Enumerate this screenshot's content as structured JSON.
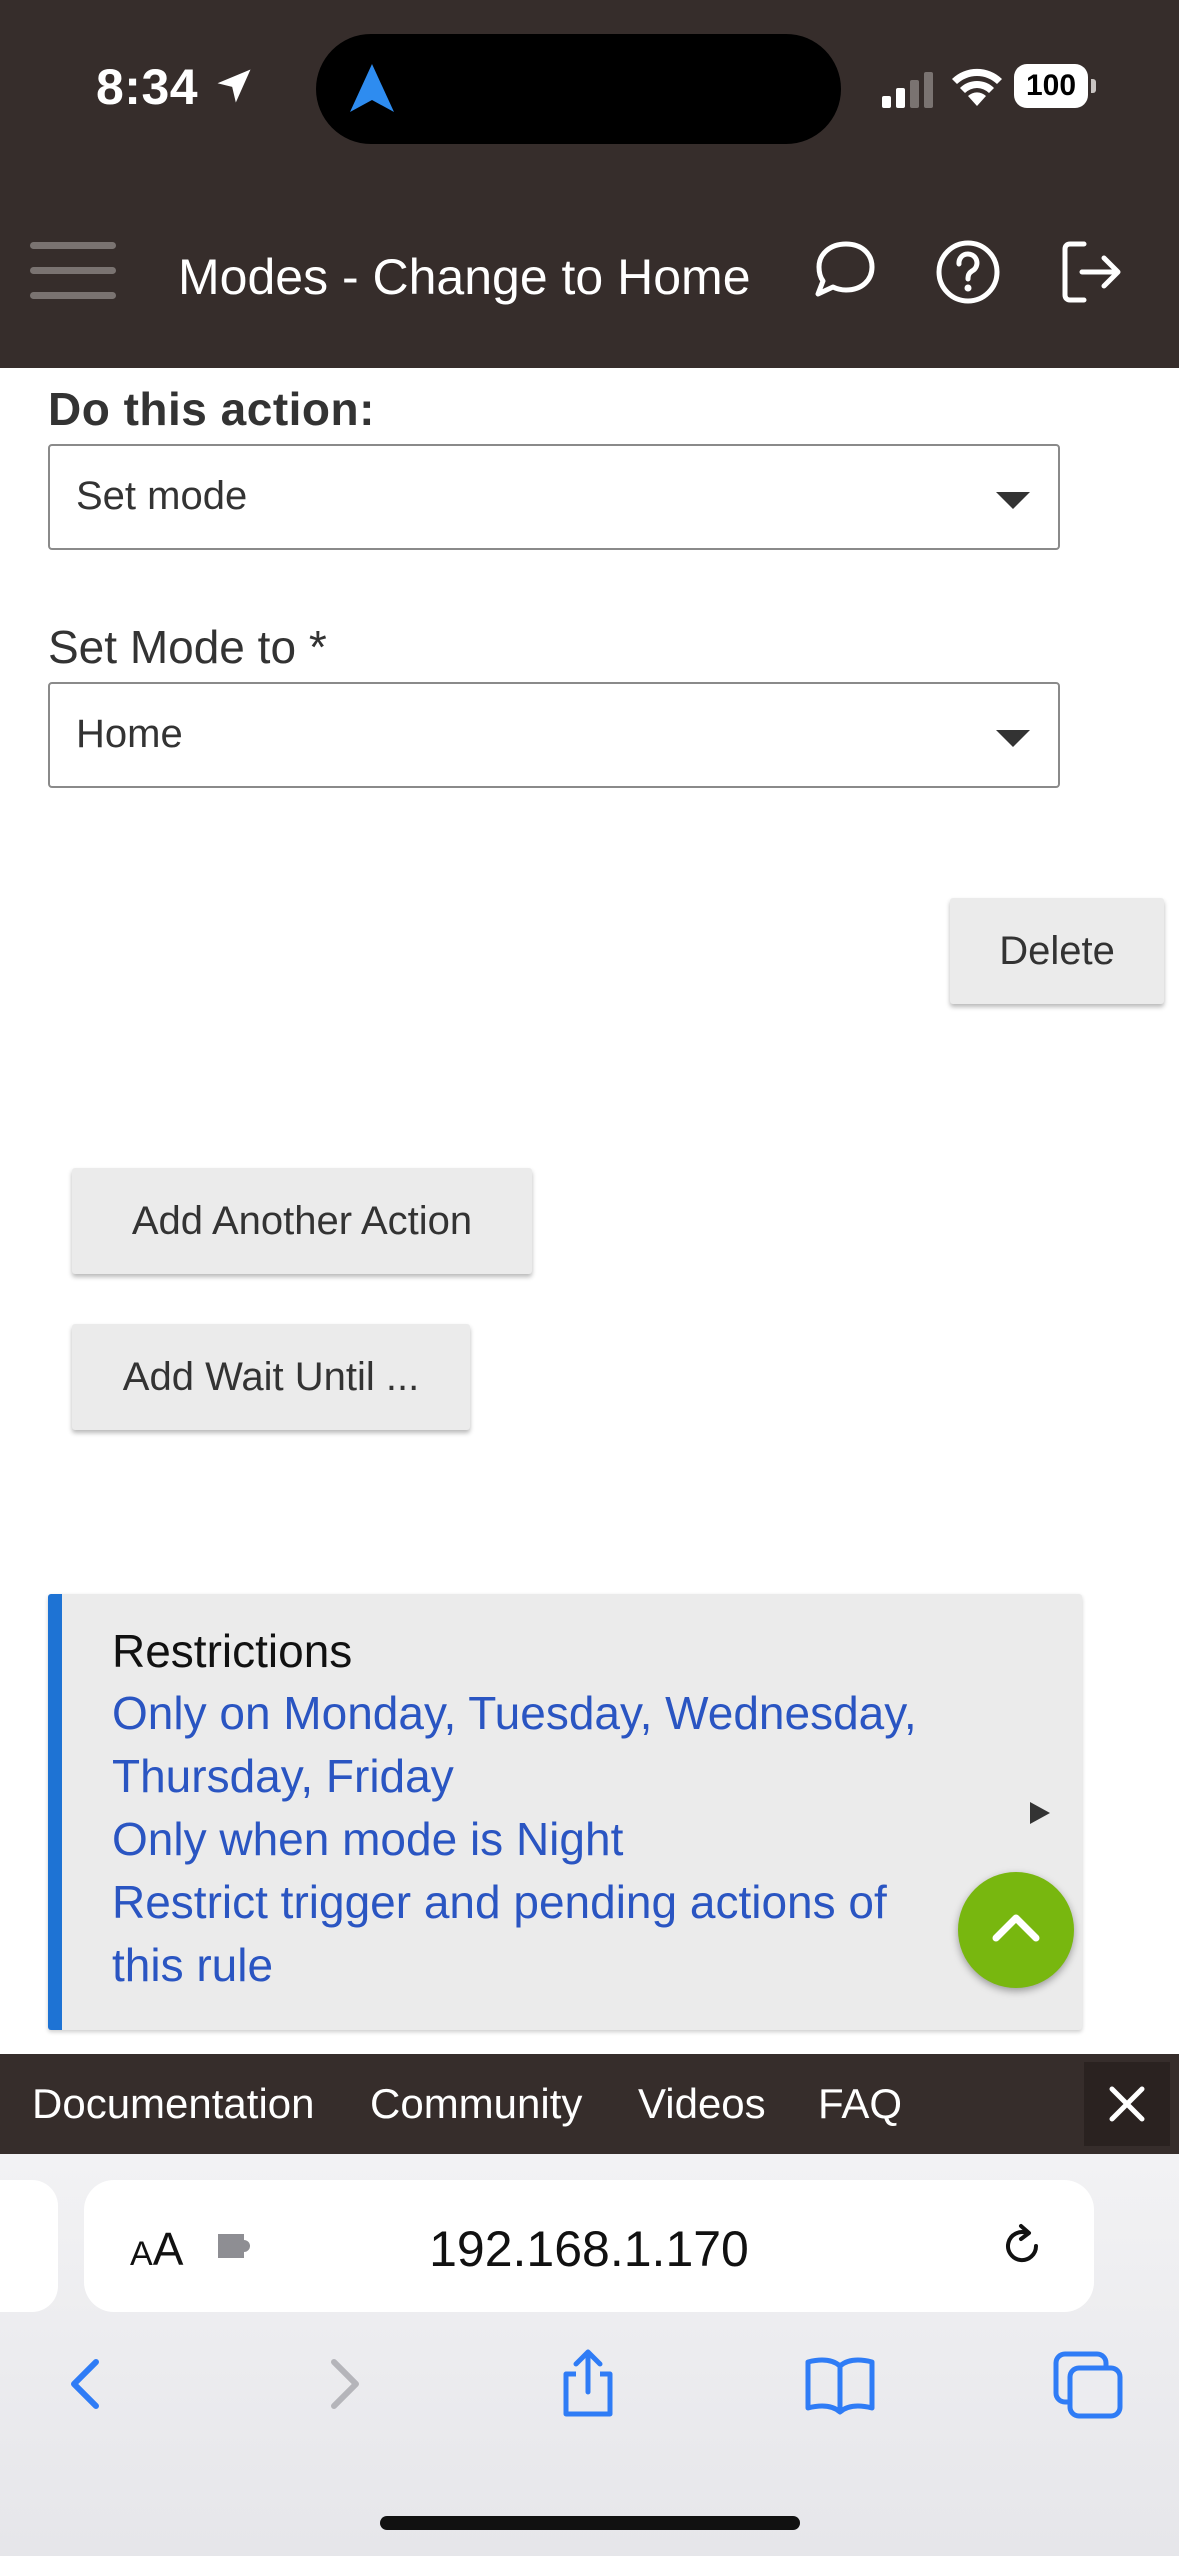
{
  "status_bar": {
    "time": "8:34",
    "battery": "100"
  },
  "header": {
    "title": "Modes - Change to Home"
  },
  "action_section": {
    "heading": "Do this action:",
    "action_select_value": "Set mode",
    "mode_label": "Set Mode to *",
    "mode_select_value": "Home"
  },
  "buttons": {
    "delete": "Delete",
    "add_action": "Add Another Action",
    "add_wait": "Add Wait Until ..."
  },
  "restrictions": {
    "title": "Restrictions",
    "lines": [
      "Only on Monday, Tuesday, Wednesday,",
      "Thursday, Friday",
      "Only when mode is Night",
      "Restrict trigger and pending actions of",
      "this rule"
    ]
  },
  "footer_links": [
    "Documentation",
    "Community",
    "Videos",
    "FAQ"
  ],
  "browser": {
    "aa": "AA",
    "url": "192.168.1.170"
  },
  "colors": {
    "header_bg": "#362d2b",
    "accent_blue": "#1e73d4",
    "link_blue": "#2a55c2",
    "fab_green": "#78b70f"
  }
}
